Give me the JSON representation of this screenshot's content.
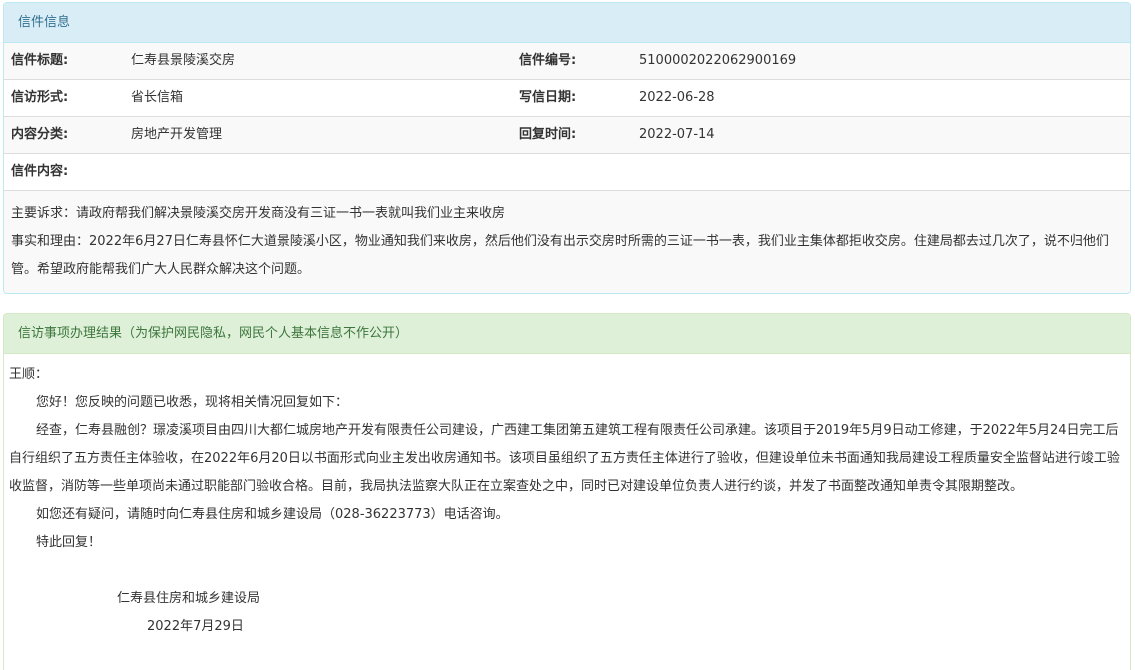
{
  "info_panel": {
    "heading": "信件信息",
    "rows": [
      {
        "label1": "信件标题:",
        "value1": "仁寿县景陵溪交房",
        "label2": "信件编号:",
        "value2": "5100002022062900169"
      },
      {
        "label1": "信访形式:",
        "value1": "省长信箱",
        "label2": "写信日期:",
        "value2": "2022-06-28"
      },
      {
        "label1": "内容分类:",
        "value1": "房地产开发管理",
        "label2": "回复时间:",
        "value2": "2022-07-14"
      }
    ],
    "content_label": "信件内容:",
    "content_lines": [
      "主要诉求：请政府帮我们解决景陵溪交房开发商没有三证一书一表就叫我们业主来收房",
      "事实和理由：2022年6月27日仁寿县怀仁大道景陵溪小区，物业通知我们来收房，然后他们没有出示交房时所需的三证一书一表，我们业主集体都拒收交房。住建局都去过几次了，说不归他们管。希望政府能帮我们广大人民群众解决这个问题。"
    ]
  },
  "reply_panel": {
    "heading": "信访事项办理结果（为保护网民隐私，网民个人基本信息不作公开）",
    "salutation": "王顺：",
    "paragraphs": [
      "您好！您反映的问题已收悉，现将相关情况回复如下：",
      "经查，仁寿县融创？璟凌溪项目由四川大都仁城房地产开发有限责任公司建设，广西建工集团第五建筑工程有限责任公司承建。该项目于2019年5月9日动工修建，于2022年5月24日完工后自行组织了五方责任主体验收，在2022年6月20日以书面形式向业主发出收房通知书。该项目虽组织了五方责任主体进行了验收，但建设单位未书面通知我局建设工程质量安全监督站进行竣工验收监督，消防等一些单项尚未通过职能部门验收合格。目前，我局执法监察大队正在立案查处之中，同时已对建设单位负责人进行约谈，并发了书面整改通知单责令其限期整改。",
      "如您还有疑问，请随时向仁寿县住房和城乡建设局（028-36223773）电话咨询。",
      "特此回复！"
    ],
    "signature_org": "仁寿县住房和城乡建设局",
    "signature_date": "2022年7月29日"
  }
}
